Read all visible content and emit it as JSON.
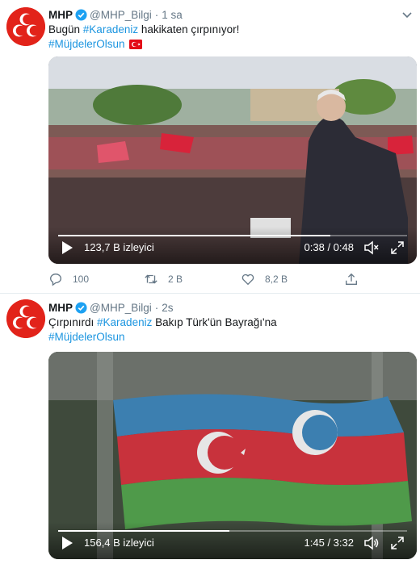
{
  "tweets": [
    {
      "author_name": "MHP",
      "handle": "@MHP_Bilgi",
      "separator": "·",
      "time": "1 sa",
      "text_prefix": "Bugün ",
      "hashtag_main": "#Karadeniz",
      "text_suffix": " hakikaten çırpınıyor!",
      "hashtag_line2": "#MüjdelerOlsun",
      "video": {
        "views": "123,7 B izleyici",
        "timecode": "0:38 / 0:48",
        "progress": 0.78
      },
      "actions": {
        "replies": "100",
        "retweets": "2 B",
        "likes": "8,2 B"
      }
    },
    {
      "author_name": "MHP",
      "handle": "@MHP_Bilgi",
      "separator": "·",
      "time": "2s",
      "text_prefix": "Çırpınırdı ",
      "hashtag_main": "#Karadeniz",
      "text_suffix": " Bakıp Türk'ün Bayrağı'na",
      "hashtag_line2": "#MüjdelerOlsun",
      "video": {
        "views": "156,4 B izleyici",
        "timecode": "1:45 / 3:32",
        "progress": 0.49
      }
    }
  ],
  "colors": {
    "brand_red": "#e2231a",
    "link": "#1b95e0",
    "verified": "#1da1f2",
    "muted": "#657786",
    "text": "#14171a"
  },
  "icons": [
    "mhp-logo-icon",
    "verified-badge-icon",
    "caret-down-icon",
    "turkey-flag-icon",
    "play-icon",
    "volume-muted-icon",
    "volume-icon",
    "fullscreen-icon",
    "reply-icon",
    "retweet-icon",
    "like-icon",
    "share-icon"
  ]
}
